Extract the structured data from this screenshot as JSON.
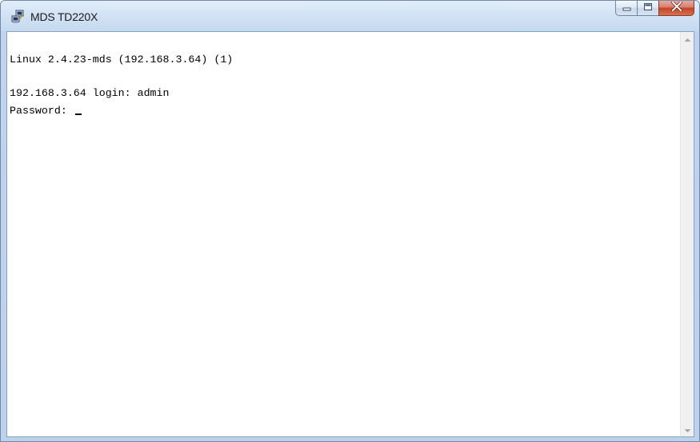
{
  "window": {
    "title": "MDS TD220X",
    "icon": "putty-terminal-icon"
  },
  "caption_buttons": {
    "minimize": "minimize-icon",
    "maximize": "maximize-icon",
    "close": "close-icon"
  },
  "terminal": {
    "lines": [
      "Linux 2.4.23-mds (192.168.3.64) (1)",
      "",
      "192.168.3.64 login: admin",
      "Password: "
    ]
  },
  "scrollbar": {
    "up_icon": "scroll-up-arrow-icon",
    "down_icon": "scroll-down-arrow-icon"
  },
  "colors": {
    "frame": "#bcd2ea",
    "close_button": "#c4442a",
    "terminal_bg": "#ffffff",
    "terminal_fg": "#000000"
  }
}
